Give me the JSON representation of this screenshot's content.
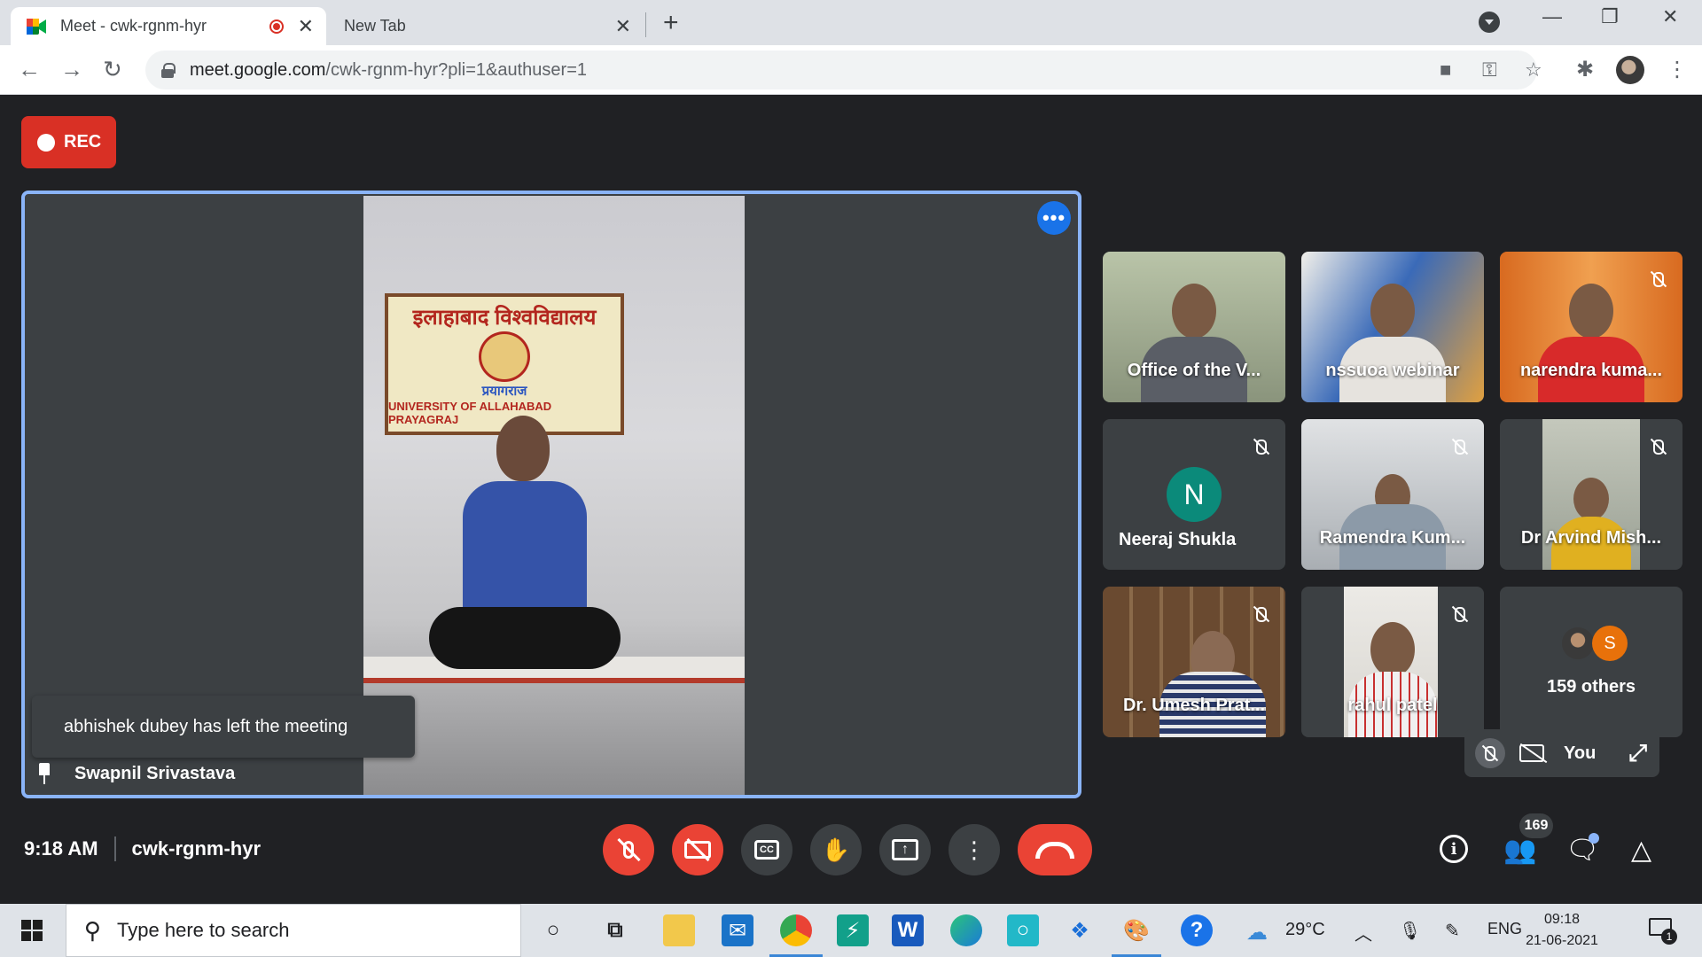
{
  "browser": {
    "tabs": [
      {
        "title": "Meet - cwk-rgnm-hyr",
        "recording": true,
        "active": true
      },
      {
        "title": "New Tab",
        "active": false
      }
    ],
    "url_host": "meet.google.com",
    "url_path": "/cwk-rgnm-hyr?pli=1&authuser=1"
  },
  "meet": {
    "rec_label": "REC",
    "main_speaker": "Swapnil Srivastava",
    "toast": "abhishek dubey has left the meeting",
    "banner": {
      "hindi": "इलाहाबाद विश्वविद्यालय",
      "city": "प्रयागराज",
      "english": "UNIVERSITY OF ALLAHABAD PRAYAGRAJ"
    },
    "participants": [
      {
        "name": "Office of the V...",
        "muted": false
      },
      {
        "name": "nssuoa webinar",
        "muted": false
      },
      {
        "name": "narendra kuma...",
        "muted": true
      },
      {
        "name": "Neeraj Shukla",
        "muted": true,
        "avatar_letter": "N"
      },
      {
        "name": "Ramendra Kum...",
        "muted": true
      },
      {
        "name": "Dr Arvind Mish...",
        "muted": true
      },
      {
        "name": "Dr. Umesh Prat...",
        "muted": true
      },
      {
        "name": "rahul patel",
        "muted": true
      }
    ],
    "others": {
      "avatar_letter": "S",
      "label": "159 others"
    },
    "self_label": "You",
    "time": "9:18 AM",
    "meeting_code": "cwk-rgnm-hyr",
    "people_count": "169"
  },
  "taskbar": {
    "search_placeholder": "Type here to search",
    "weather": "29°C",
    "language": "ENG",
    "clock_time": "09:18",
    "clock_date": "21-06-2021",
    "notification_count": "1",
    "word_letter": "W"
  },
  "colors": {
    "meet_bg": "#202124",
    "tile_bg": "#3c4043",
    "accent_blue": "#8ab4f8",
    "danger_red": "#ea4335"
  }
}
